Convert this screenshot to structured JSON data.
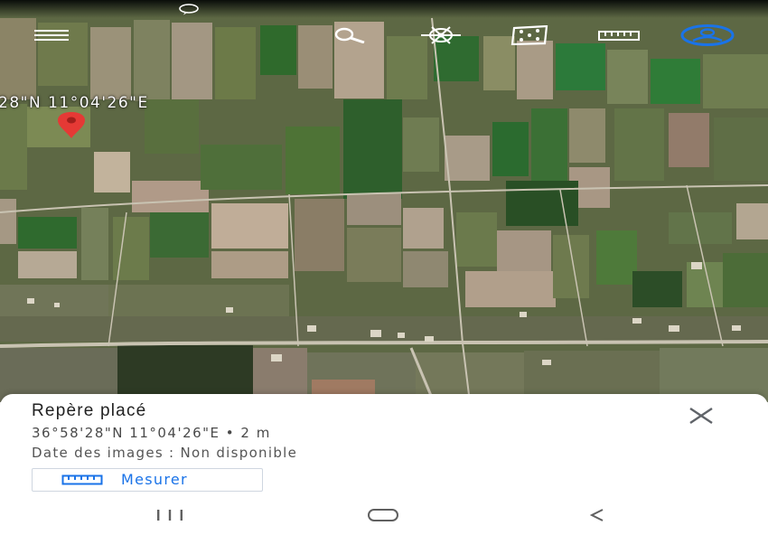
{
  "map": {
    "coordinate_overlay": "28\"N 11°04'26\"E",
    "marker_icon": "red-map-pin"
  },
  "toolbar": {
    "menu_icon": "hamburger-menu-icon",
    "search_icon": "search-icon",
    "voyager_icon": "ship-wheel-icon",
    "feeling_lucky_icon": "dice-icon",
    "measure_icon": "ruler-icon",
    "account_icon": "account-icon"
  },
  "place_sheet": {
    "title": "Repère placé",
    "coordinates": "36°58'28\"N 11°04'26\"E • 2 m",
    "imagery_date": "Date des images : Non disponible",
    "measure_button_label": "Mesurer",
    "close_icon": "close-icon"
  },
  "nav_bar": {
    "recents_icon": "recents-icon",
    "home_icon": "home-icon",
    "back_icon": "back-icon"
  },
  "colors": {
    "accent_blue": "#1a73e8",
    "pin_red": "#e53935"
  }
}
